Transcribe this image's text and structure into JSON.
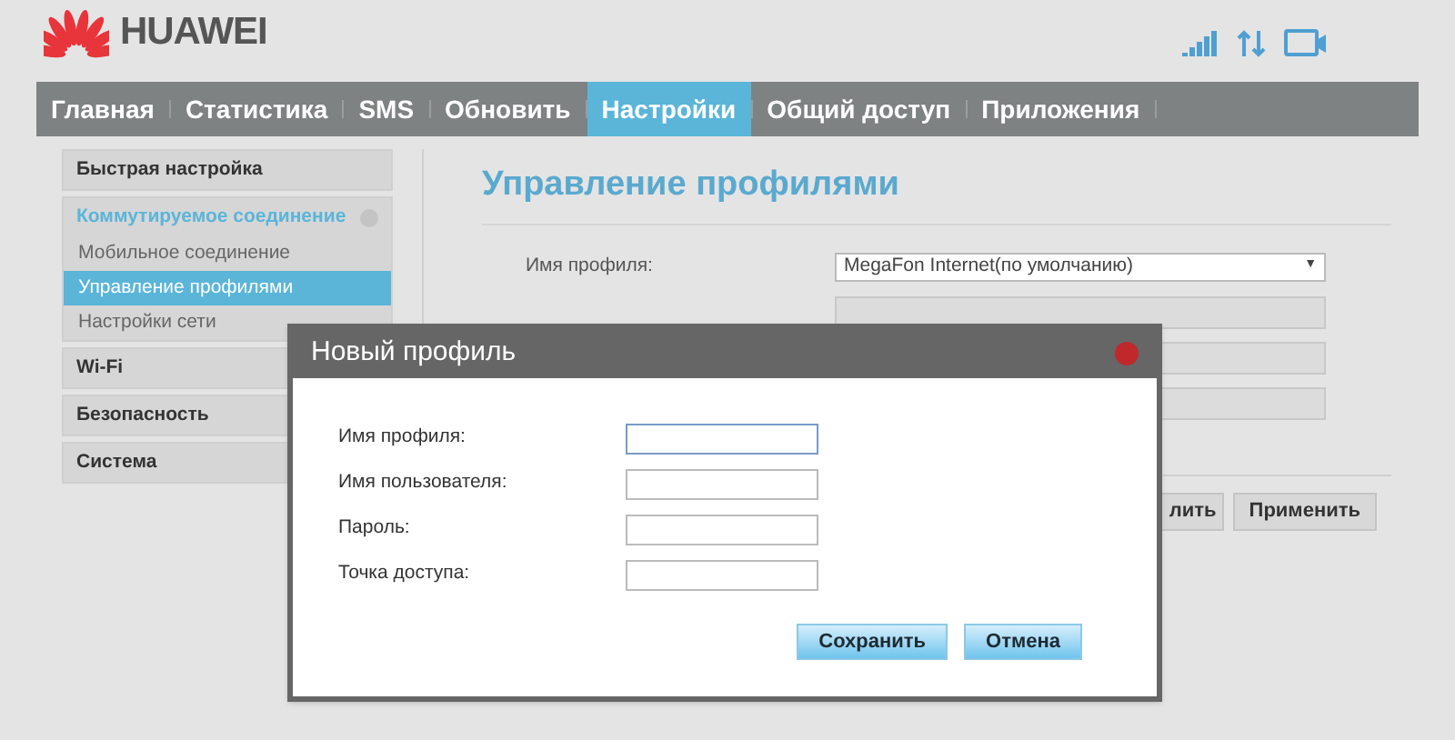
{
  "header": {
    "logo_text": "HUAWEI"
  },
  "nav": {
    "tabs": [
      {
        "label": "Главная",
        "selected": false
      },
      {
        "label": "Статистика",
        "selected": false
      },
      {
        "label": "SMS",
        "selected": false
      },
      {
        "label": "Обновить",
        "selected": false
      },
      {
        "label": "Настройки",
        "selected": true
      },
      {
        "label": "Общий доступ",
        "selected": false
      },
      {
        "label": "Приложения",
        "selected": false
      }
    ]
  },
  "sidebar": {
    "items": [
      {
        "label": "Быстрая настройка",
        "expanded": false
      },
      {
        "label": "Коммутируемое соединение",
        "expanded": true,
        "children": [
          {
            "label": "Мобильное соединение",
            "selected": false
          },
          {
            "label": "Управление профилями",
            "selected": true
          },
          {
            "label": "Настройки сети",
            "selected": false
          }
        ]
      },
      {
        "label": "Wi-Fi",
        "expanded": false
      },
      {
        "label": "Безопасность",
        "expanded": false
      },
      {
        "label": "Система",
        "expanded": false
      }
    ]
  },
  "content": {
    "title": "Управление профилями",
    "fields": [
      {
        "kind": "select",
        "label": "Имя профиля:",
        "value": "MegaFon Internet(по умолчанию)",
        "arrow": "▼"
      },
      {
        "kind": "input",
        "disabled": true
      },
      {
        "kind": "input",
        "disabled": true
      },
      {
        "kind": "input",
        "disabled": true
      }
    ],
    "buttons": [
      "лить",
      "Применить"
    ]
  },
  "dialog": {
    "title": "Новый профиль",
    "fields": [
      {
        "label": "Имя профиля:",
        "focused": true
      },
      {
        "label": "Имя пользователя:",
        "focused": false
      },
      {
        "label": "Пароль:",
        "focused": false
      },
      {
        "label": "Точка доступа:",
        "focused": false
      }
    ],
    "buttons": [
      "Сохранить",
      "Отмена"
    ]
  }
}
